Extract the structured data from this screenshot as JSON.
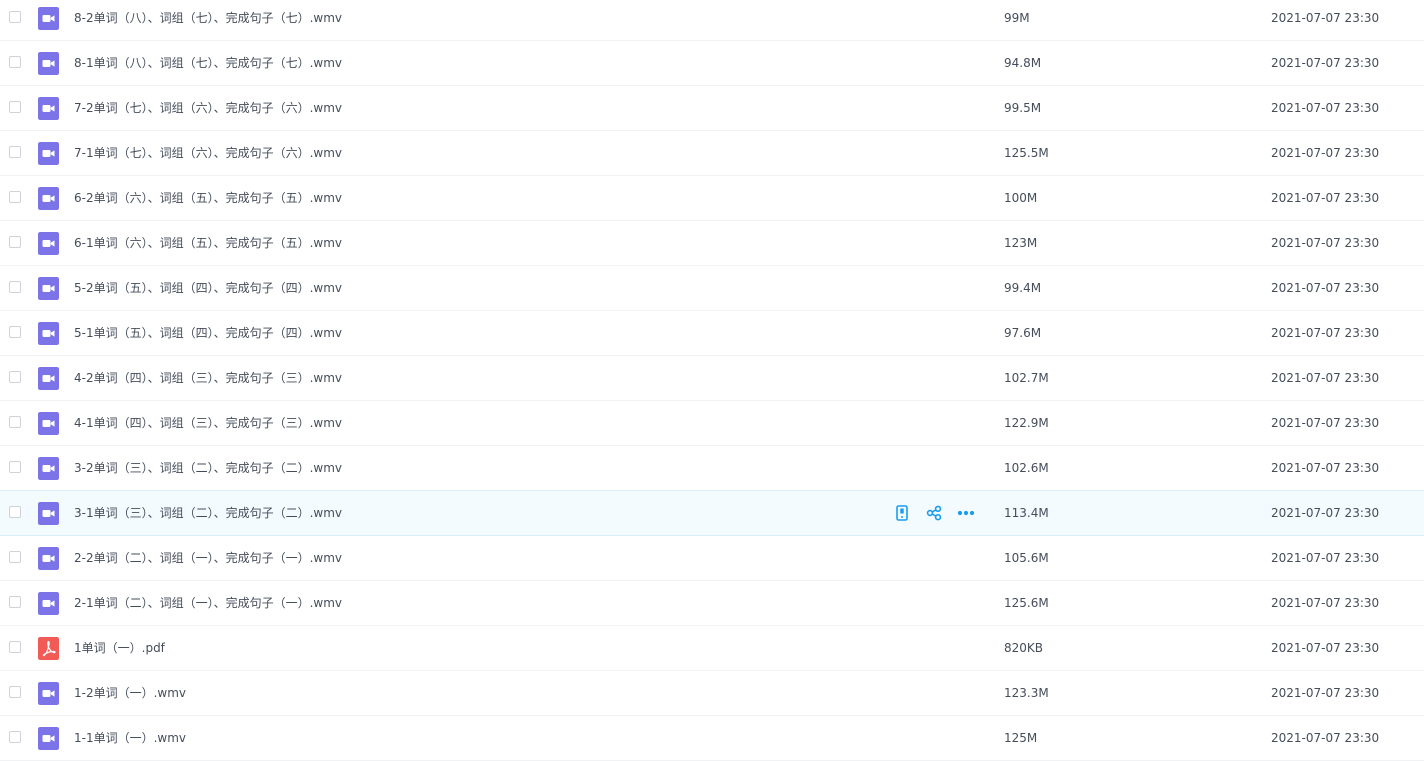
{
  "files": [
    {
      "name": "8-2单词（八）、词组（七）、完成句子（七）.wmv",
      "type": "video",
      "size": "99M",
      "modified": "2021-07-07 23:30"
    },
    {
      "name": "8-1单词（八）、词组（七）、完成句子（七）.wmv",
      "type": "video",
      "size": "94.8M",
      "modified": "2021-07-07 23:30"
    },
    {
      "name": "7-2单词（七）、词组（六）、完成句子（六）.wmv",
      "type": "video",
      "size": "99.5M",
      "modified": "2021-07-07 23:30"
    },
    {
      "name": "7-1单词（七）、词组（六）、完成句子（六）.wmv",
      "type": "video",
      "size": "125.5M",
      "modified": "2021-07-07 23:30"
    },
    {
      "name": "6-2单词（六）、词组（五）、完成句子（五）.wmv",
      "type": "video",
      "size": "100M",
      "modified": "2021-07-07 23:30"
    },
    {
      "name": "6-1单词（六）、词组（五）、完成句子（五）.wmv",
      "type": "video",
      "size": "123M",
      "modified": "2021-07-07 23:30"
    },
    {
      "name": "5-2单词（五）、词组（四）、完成句子（四）.wmv",
      "type": "video",
      "size": "99.4M",
      "modified": "2021-07-07 23:30"
    },
    {
      "name": "5-1单词（五）、词组（四）、完成句子（四）.wmv",
      "type": "video",
      "size": "97.6M",
      "modified": "2021-07-07 23:30"
    },
    {
      "name": "4-2单词（四）、词组（三）、完成句子（三）.wmv",
      "type": "video",
      "size": "102.7M",
      "modified": "2021-07-07 23:30"
    },
    {
      "name": "4-1单词（四）、词组（三）、完成句子（三）.wmv",
      "type": "video",
      "size": "122.9M",
      "modified": "2021-07-07 23:30"
    },
    {
      "name": "3-2单词（三）、词组（二）、完成句子（二）.wmv",
      "type": "video",
      "size": "102.6M",
      "modified": "2021-07-07 23:30"
    },
    {
      "name": "3-1单词（三）、词组（二）、完成句子（二）.wmv",
      "type": "video",
      "size": "113.4M",
      "modified": "2021-07-07 23:30",
      "hovered": true
    },
    {
      "name": "2-2单词（二）、词组（一）、完成句子（一）.wmv",
      "type": "video",
      "size": "105.6M",
      "modified": "2021-07-07 23:30"
    },
    {
      "name": "2-1单词（二）、词组（一）、完成句子（一）.wmv",
      "type": "video",
      "size": "125.6M",
      "modified": "2021-07-07 23:30"
    },
    {
      "name": "1单词（一）.pdf",
      "type": "pdf",
      "size": "820KB",
      "modified": "2021-07-07 23:30"
    },
    {
      "name": "1-2单词（一）.wmv",
      "type": "video",
      "size": "123.3M",
      "modified": "2021-07-07 23:30"
    },
    {
      "name": "1-1单词（一）.wmv",
      "type": "video",
      "size": "125M",
      "modified": "2021-07-07 23:30"
    }
  ],
  "row_actions": [
    "phone-icon",
    "share-icon",
    "more-icon"
  ],
  "colors": {
    "video_icon": "#7d73e8",
    "pdf_icon": "#f25a55",
    "action_icon": "#1a9cf0",
    "hover_row": "#f4fbff"
  }
}
